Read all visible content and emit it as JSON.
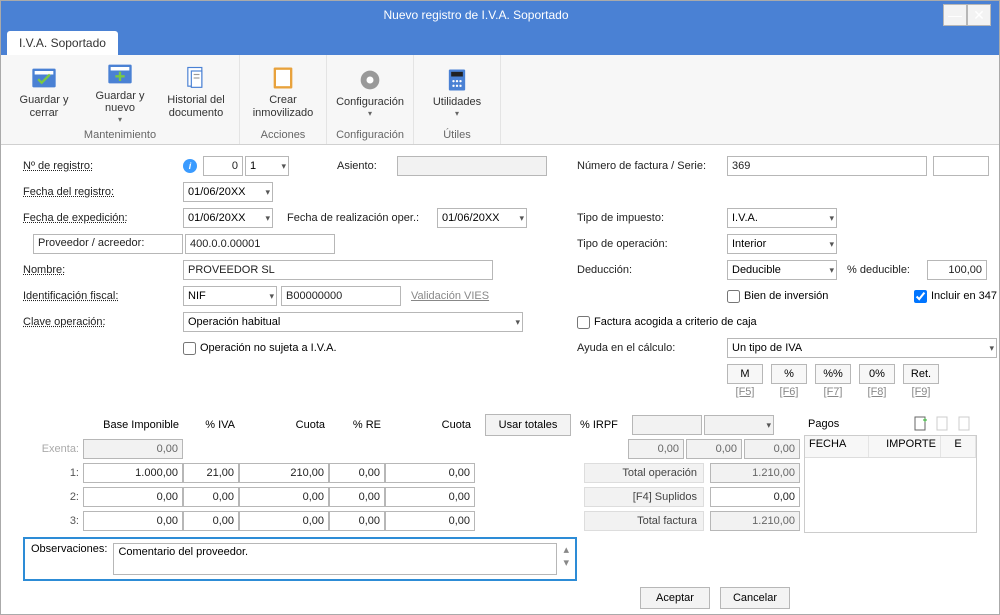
{
  "window": {
    "title": "Nuevo registro de I.V.A. Soportado"
  },
  "tabs": {
    "main": "I.V.A. Soportado"
  },
  "ribbon": {
    "mantenimiento": {
      "caption": "Mantenimiento",
      "guardar_cerrar": "Guardar y cerrar",
      "guardar_nuevo": "Guardar y nuevo",
      "historial": "Historial del documento"
    },
    "acciones": {
      "caption": "Acciones",
      "crear": "Crear inmovilizado"
    },
    "config": {
      "caption": "Configuración",
      "configuracion": "Configuración"
    },
    "utiles": {
      "caption": "Útiles",
      "utilidades": "Utilidades"
    }
  },
  "left": {
    "nregistro_label": "Nº de registro:",
    "nregistro_val": "0",
    "nregistro_seq": "1",
    "asiento_label": "Asiento:",
    "asiento_val": "",
    "fecha_registro_label": "Fecha del registro:",
    "fecha_registro_val": "01/06/20XX",
    "fecha_exped_label": "Fecha de expedición:",
    "fecha_exped_val": "01/06/20XX",
    "fecha_realiz_label": "Fecha de realización oper.:",
    "fecha_realiz_val": "01/06/20XX",
    "proveedor_label": "Proveedor / acreedor:",
    "proveedor_val": "400.0.0.00001",
    "nombre_label": "Nombre:",
    "nombre_val": "PROVEEDOR SL",
    "ident_fiscal_label": "Identificación fiscal:",
    "ident_fiscal_type": "NIF",
    "ident_fiscal_val": "B00000000",
    "validacion_vies": "Validación VIES",
    "clave_op_label": "Clave operación:",
    "clave_op_val": "Operación habitual",
    "op_no_sujeta": "Operación no sujeta a I.V.A."
  },
  "right": {
    "nfact_label": "Número de factura / Serie:",
    "nfact_val": "369",
    "serie_val": "",
    "tipo_imp_label": "Tipo de impuesto:",
    "tipo_imp_val": "I.V.A.",
    "tipo_op_label": "Tipo de operación:",
    "tipo_op_val": "Interior",
    "deduccion_label": "Deducción:",
    "deduccion_val": "Deducible",
    "pct_deducible_label": "% deducible:",
    "pct_deducible_val": "100,00",
    "bien_inversion": "Bien de inversión",
    "incluir_347": "Incluir en 347",
    "factura_caja": "Factura acogida a criterio de caja",
    "ayuda_calc_label": "Ayuda en el cálculo:",
    "ayuda_calc_val": "Un tipo de IVA",
    "calc_btns": [
      "M",
      "%",
      "%%",
      "0%",
      "Ret."
    ],
    "calc_hints": [
      "[F5]",
      "[F6]",
      "[F7]",
      "[F8]",
      "[F9]"
    ]
  },
  "grid": {
    "headers": {
      "base": "Base Imponible",
      "iva": "% IVA",
      "cuota": "Cuota",
      "re": "% RE",
      "cuota2": "Cuota"
    },
    "usar_totales": "Usar totales",
    "irpf_label": "% IRPF",
    "exenta_label": "Exenta:",
    "exenta_val": "0,00",
    "rows": [
      {
        "n": "1:",
        "base": "1.000,00",
        "iva": "21,00",
        "cuota": "210,00",
        "re": "0,00",
        "cuota2": "0,00"
      },
      {
        "n": "2:",
        "base": "0,00",
        "iva": "0,00",
        "cuota": "0,00",
        "re": "0,00",
        "cuota2": "0,00"
      },
      {
        "n": "3:",
        "base": "0,00",
        "iva": "0,00",
        "cuota": "0,00",
        "re": "0,00",
        "cuota2": "0,00"
      }
    ],
    "irpf_vals": [
      "0,00",
      "0,00",
      "0,00"
    ],
    "totals": {
      "op_label": "Total operación",
      "op_val": "1.210,00",
      "supl_label": "[F4] Suplidos",
      "supl_val": "0,00",
      "fact_label": "Total factura",
      "fact_val": "1.210,00"
    }
  },
  "pagos": {
    "label": "Pagos",
    "cols": {
      "fecha": "FECHA",
      "importe": "IMPORTE",
      "e": "E"
    }
  },
  "obs": {
    "label": "Observaciones:",
    "val": "Comentario del proveedor."
  },
  "footer": {
    "aceptar": "Aceptar",
    "cancelar": "Cancelar"
  }
}
